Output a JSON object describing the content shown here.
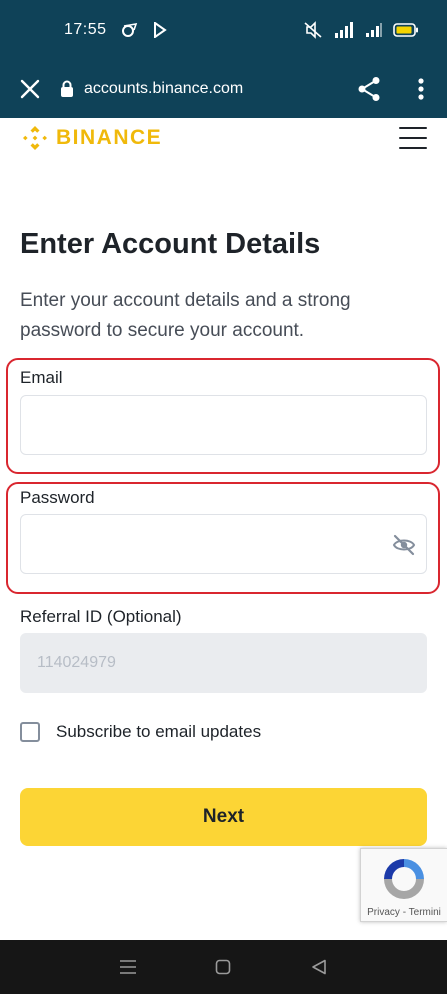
{
  "status_bar": {
    "time": "17:55"
  },
  "browser": {
    "url": "accounts.binance.com"
  },
  "site": {
    "brand": "BINANCE"
  },
  "form": {
    "title": "Enter Account Details",
    "subtitle": "Enter your account details and a strong password to secure your account.",
    "email_label": "Email",
    "email_value": "",
    "password_label": "Password",
    "password_value": "",
    "referral_label": "Referral ID (Optional)",
    "referral_value": "114024979",
    "subscribe_label": "Subscribe to email updates",
    "subscribe_checked": false,
    "next_label": "Next"
  },
  "recaptcha": {
    "links": "Privacy - Termini"
  },
  "colors": {
    "system_bar": "#0f4258",
    "brand_yellow": "#f0b90b",
    "button_yellow": "#fcd535",
    "highlight_red": "#d9262f",
    "nav_bar": "#161616"
  },
  "icons": {
    "close": "close-icon",
    "lock": "lock-icon",
    "share": "share-icon",
    "more": "more-vertical-icon",
    "menu": "hamburger-menu-icon",
    "eye": "eye-off-icon",
    "recaptcha": "recaptcha-logo-icon"
  }
}
